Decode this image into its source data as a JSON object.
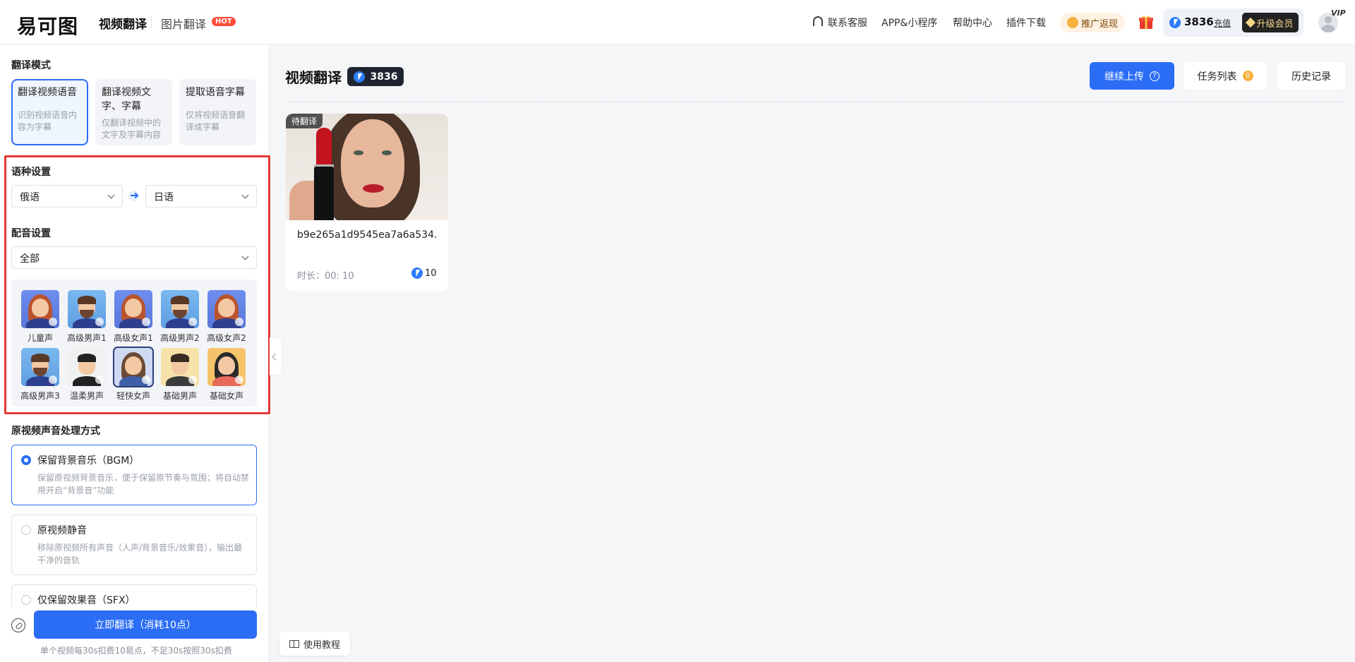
{
  "header": {
    "logo": "易可图",
    "nav_active": "视频翻译",
    "nav_image": "图片翻译",
    "hot_badge": "HOT",
    "support": "联系客服",
    "app": "APP&小程序",
    "help": "帮助中心",
    "plugin": "插件下载",
    "promo": "推广返现",
    "balance": "3836",
    "recharge": "充值",
    "upgrade": "升级会员",
    "vip_tag": "VIP"
  },
  "left": {
    "mode_title": "翻译模式",
    "modes": [
      {
        "title": "翻译视频语音",
        "desc": "识别视频语音内容为字幕"
      },
      {
        "title": "翻译视频文字、字幕",
        "desc": "仅翻译视频中的文字及字幕内容"
      },
      {
        "title": "提取语音字幕",
        "desc": "仅将视频语音翻译成字幕"
      }
    ],
    "lang_title": "语种设置",
    "source_lang": "俄语",
    "target_lang": "日语",
    "dub_title": "配音设置",
    "dub_filter": "全部",
    "voices": [
      {
        "label": "儿童声"
      },
      {
        "label": "高级男声1"
      },
      {
        "label": "高级女声1"
      },
      {
        "label": "高级男声2"
      },
      {
        "label": "高级女声2"
      },
      {
        "label": "高级男声3"
      },
      {
        "label": "温柔男声"
      },
      {
        "label": "轻快女声"
      },
      {
        "label": "基础男声"
      },
      {
        "label": "基础女声"
      }
    ],
    "audio_title": "原视频声音处理方式",
    "audio_options": [
      {
        "title": "保留背景音乐（BGM）",
        "desc": "保留原视频背景音乐，便于保留原节奏与氛围；将自动禁用开启“背景音”功能"
      },
      {
        "title": "原视频静音",
        "desc": "移除原视频所有声音（人声/背景音乐/效果音），输出最干净的音轨"
      },
      {
        "title": "仅保留效果音（SFX）"
      }
    ],
    "translate_button": "立即翻译（消耗10点）",
    "footnote": "单个视频每30s扣费10易点，不足30s按照30s扣费"
  },
  "main": {
    "title": "视频翻译",
    "points": "3836",
    "upload": "继续上传",
    "tasks": "任务列表",
    "tasks_count": "0",
    "history": "历史记录",
    "video": {
      "status": "待翻译",
      "name": "b9e265a1d9545ea7a6a534...",
      "duration": "时长：00: 10",
      "cost": "10"
    },
    "tutorial": "使用教程"
  }
}
